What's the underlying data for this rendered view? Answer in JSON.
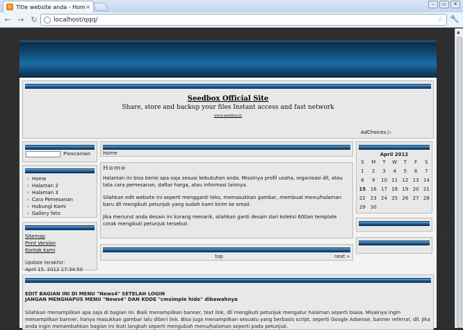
{
  "browser": {
    "tab_title": "Title website anda - Home",
    "url": "localhost/qqq/",
    "favicon": "G"
  },
  "ad": {
    "title": "Seedbox Official Site",
    "desc": "Share, store and backup your files Instant access and fast network",
    "url": "www.seedbox.fr",
    "choices": "AdChoices ▷"
  },
  "search": {
    "button": "Pencarian"
  },
  "menu": [
    "Home",
    "Halaman 2",
    "Halaman 3",
    "Cara Pemesanan",
    "Hubungi Kami",
    "Gallery foto"
  ],
  "links": [
    "Sitemap",
    "Print Version",
    "Kontak kami"
  ],
  "update": {
    "label": "Update terakhir:",
    "value": "April 15. 2012 17:34:50"
  },
  "breadcrumb": "Home",
  "content": {
    "heading": "Home",
    "p1": "Halaman ini bisa berisi apa saja sesuai kebutuhan anda. Misalnya profil usaha, organisasi dll, atau tata cara pemesanan, daftar harga, atau informasi lainnya.",
    "p2": "Silahkan edit website ini seperti mengganti teks, memasukkan gambar, membuat menu/halaman baru dll mengikuti petunjuk yang sudah kami kirim ke email.",
    "p3": "Jika menurut anda desain ini kurang menarik, silahkan ganti desain dari koleksi 600an template corak mengikuti petunjuk tersebut."
  },
  "pager": {
    "top": "top",
    "next": "next »"
  },
  "calendar": {
    "month": "April 2012",
    "days": [
      "S",
      "M",
      "T",
      "W",
      "T",
      "F",
      "S"
    ],
    "weeks": [
      [
        "1",
        "2",
        "3",
        "4",
        "5",
        "6",
        "7"
      ],
      [
        "8",
        "9",
        "10",
        "11",
        "12",
        "13",
        "14"
      ],
      [
        "15",
        "16",
        "17",
        "18",
        "19",
        "20",
        "21"
      ],
      [
        "22",
        "23",
        "24",
        "25",
        "26",
        "27",
        "28"
      ],
      [
        "29",
        "30",
        "",
        "",
        "",
        "",
        ""
      ]
    ]
  },
  "bottom": {
    "line1": "EDIT BAGIAN INI DI MENU \"News4\" SETELAH LOGIN",
    "line2": "JANGAN MENGHAPUS MENU \"News4\" DAN KODE \"cmsimple hide\" dibawahnya",
    "text": "Silahkan menampilkan apa saja di bagian ini. Baik menampilkan banner, text link, dll mengikuti petunjuk mengatur halaman seperti biasa. Misalnya ingin menampilkan banner, hanya masukkan gambar lalu diberi link. Bisa juga menampilkan sesuatu yang berbasis script, seperti Google Adsense, banner referral, dll. Jika anda ingin menambahkan bagian ini ikuti langkah seperti mengubah menu/halaman seperti pada petunjuk."
  }
}
